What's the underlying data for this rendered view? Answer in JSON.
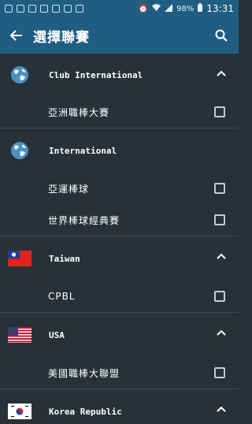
{
  "statusbar": {
    "battery": "98%",
    "time": "13:31"
  },
  "appbar": {
    "title": "選擇聯賽",
    "back_icon": "arrow-left-icon",
    "search_icon": "search-icon"
  },
  "colors": {
    "appbar": "#1f5e82",
    "background": "#263238",
    "divider": "#3c4a52",
    "checkbox": "#c5cbcf"
  },
  "groups": [
    {
      "title": "Club International",
      "icon": "globe-icon",
      "items": [
        {
          "label": "亞洲職棒大賽"
        }
      ]
    },
    {
      "title": "International",
      "icon": "globe-icon",
      "items": [
        {
          "label": "亞運棒球"
        },
        {
          "label": "世界棒球經典賽"
        }
      ]
    },
    {
      "title": "Taiwan",
      "icon": "taiwan-flag-icon",
      "items": [
        {
          "label": "CPBL"
        }
      ]
    },
    {
      "title": "USA",
      "icon": "usa-flag-icon",
      "items": [
        {
          "label": "美國職棒大聯盟"
        }
      ]
    },
    {
      "title": "Korea Republic",
      "icon": "korea-flag-icon",
      "items": []
    }
  ]
}
